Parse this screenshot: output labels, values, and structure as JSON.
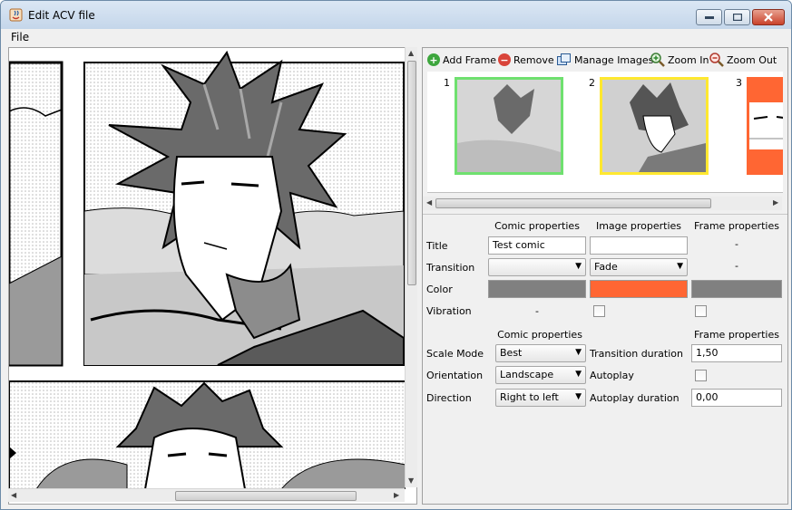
{
  "window": {
    "title": "Edit ACV file",
    "accent": "#dbe7f4"
  },
  "menu": {
    "file": "File"
  },
  "toolbar": {
    "add_frame": "Add Frame",
    "remove": "Remove",
    "manage_images": "Manage Images",
    "zoom_in": "Zoom In",
    "zoom_out": "Zoom Out"
  },
  "frames": [
    {
      "number": "1",
      "border_color": "#6fe06f"
    },
    {
      "number": "2",
      "border_color": "#ffe830"
    },
    {
      "number": "3",
      "border_color": "#ff6633"
    }
  ],
  "props": {
    "col_comic": "Comic properties",
    "col_image": "Image properties",
    "col_frame": "Frame properties",
    "row_title": "Title",
    "row_transition": "Transition",
    "row_color": "Color",
    "row_vibration": "Vibration",
    "title_comic_value": "Test comic",
    "title_image_value": "",
    "title_frame_value": "-",
    "transition_comic_value": "",
    "transition_image_value": "Fade",
    "transition_frame_value": "-",
    "color_comic": "#808080",
    "color_image": "#ff6633",
    "color_frame": "#808080",
    "vibration_comic_value": "-",
    "vibration_image_checked": false,
    "vibration_frame_checked": false
  },
  "lower": {
    "comic_header": "Comic properties",
    "frame_header": "Frame properties",
    "scale_mode_label": "Scale Mode",
    "scale_mode_value": "Best",
    "orientation_label": "Orientation",
    "orientation_value": "Landscape",
    "direction_label": "Direction",
    "direction_value": "Right to left",
    "transition_duration_label": "Transition duration",
    "transition_duration_value": "1,50",
    "autoplay_label": "Autoplay",
    "autoplay_checked": false,
    "autoplay_duration_label": "Autoplay duration",
    "autoplay_duration_value": "0,00"
  }
}
